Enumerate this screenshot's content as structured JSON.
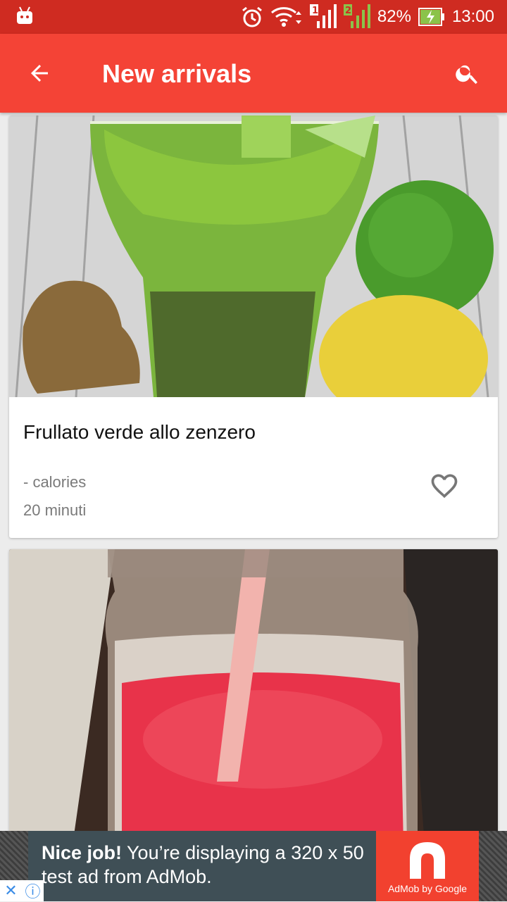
{
  "status_bar": {
    "battery": "82%",
    "time": "13:00",
    "sim1": "1",
    "sim2": "2"
  },
  "app_bar": {
    "title": "New arrivals"
  },
  "cards": [
    {
      "title": "Frullato verde allo zenzero",
      "calories": "- calories",
      "time": "20 minuti"
    },
    {
      "title": ""
    }
  ],
  "ad": {
    "headline": "Nice job!",
    "text": " You’re displaying a 320 x 50 test ad from AdMob.",
    "brand": "AdMob by Google"
  },
  "colors": {
    "primary": "#f44336",
    "primary_dark": "#cf2b21",
    "ad_bg": "#3f4f56",
    "ad_accent": "#f2412f"
  }
}
